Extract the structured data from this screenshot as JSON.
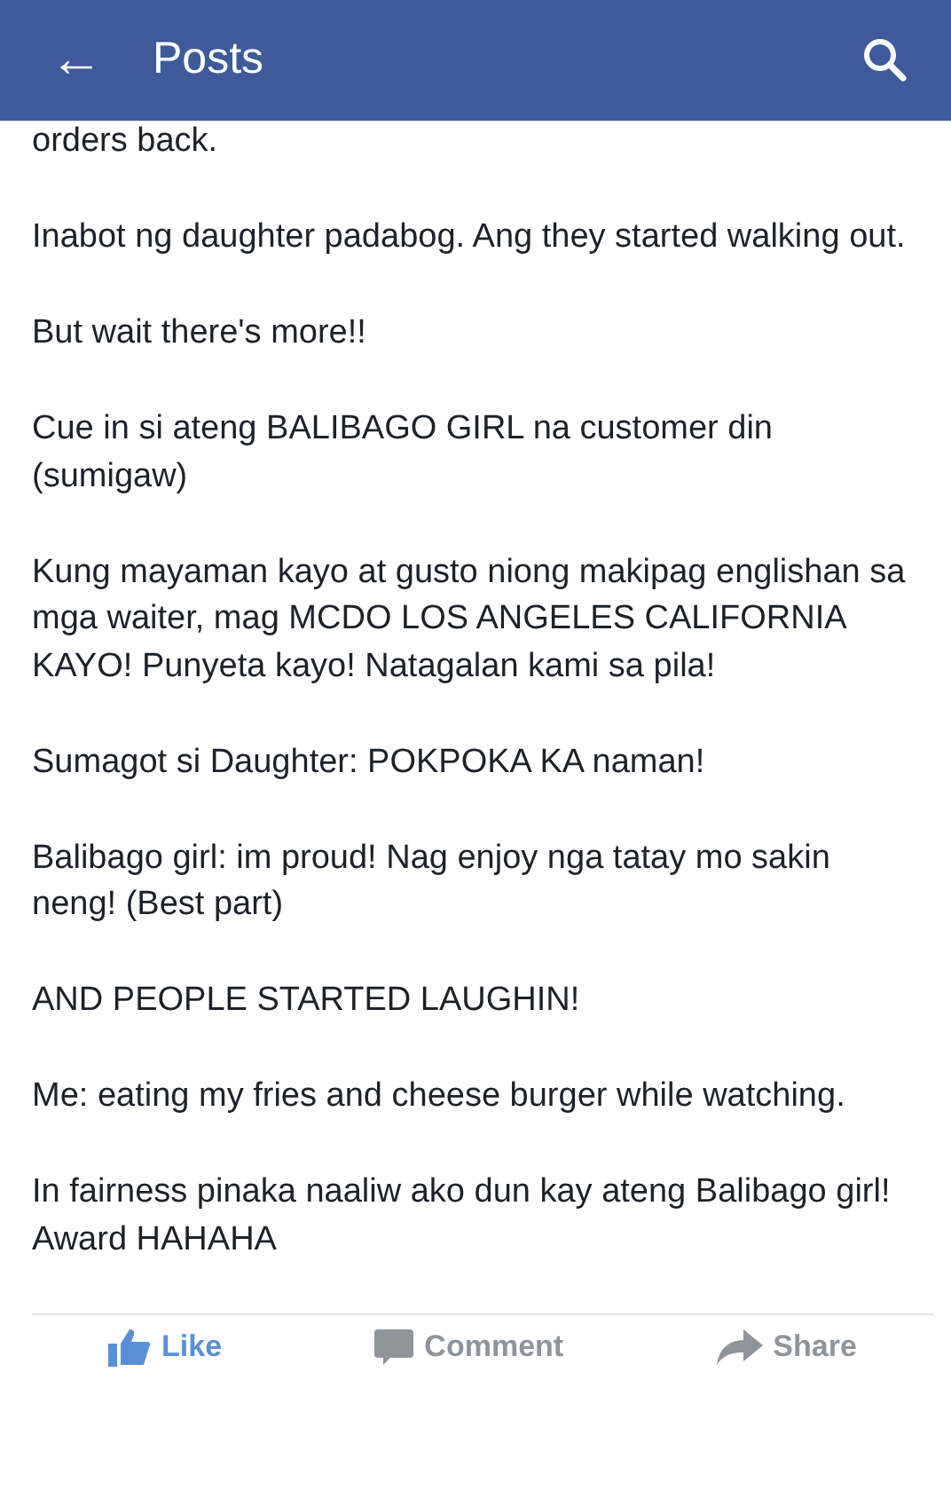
{
  "header": {
    "back_icon": "←",
    "title": "Posts"
  },
  "paragraphs": [
    "orders back.",
    "Inabot ng daughter padabog. Ang they started walking out.",
    "But wait there's more!!",
    "Cue in si ateng BALIBAGO GIRL na customer din (sumigaw)",
    "Kung mayaman kayo at gusto niong makipag englishan sa mga waiter, mag MCDO LOS ANGELES CALIFORNIA KAYO! Punyeta kayo! Natagalan kami sa pila!",
    "Sumagot si Daughter: POKPOKA KA naman!",
    "Balibago girl: im proud! Nag enjoy nga tatay mo sakin neng! (Best part)",
    "AND PEOPLE STARTED LAUGHIN!",
    "Me: eating my fries and cheese burger while watching.",
    "In fairness pinaka naaliw ako dun kay ateng Balibago girl! Award HAHAHA"
  ],
  "actions": [
    {
      "kind": "like",
      "label": "Like",
      "selected": true
    },
    {
      "kind": "comment",
      "label": "Comment",
      "selected": false
    },
    {
      "kind": "share",
      "label": "Share",
      "selected": false
    }
  ]
}
